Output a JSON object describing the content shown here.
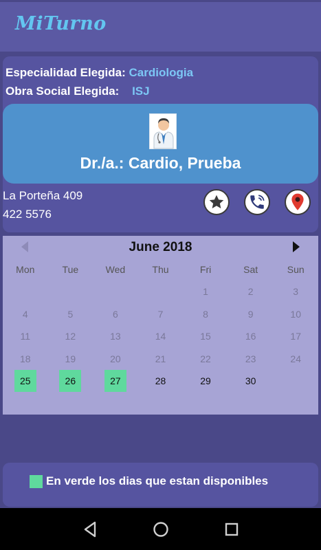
{
  "app": {
    "title": "MiTurno"
  },
  "info": {
    "specialty_label": "Especialidad Elegida:",
    "specialty_value": "Cardiologia",
    "insurance_label": "Obra Social Elegida:",
    "insurance_value": "ISJ"
  },
  "doctor": {
    "name": "Dr./a.: Cardio, Prueba",
    "address": "La Porteña 409",
    "phone": "422 5576"
  },
  "actions": {
    "favorite_icon": "star-icon",
    "call_icon": "phone-icon",
    "map_icon": "map-pin-icon"
  },
  "calendar": {
    "month_label": "June 2018",
    "weekdays": [
      "Mon",
      "Tue",
      "Wed",
      "Thu",
      "Fri",
      "Sat",
      "Sun"
    ],
    "days": [
      {
        "n": "1",
        "state": "past"
      },
      {
        "n": "2",
        "state": "past"
      },
      {
        "n": "3",
        "state": "past"
      },
      {
        "n": "4",
        "state": "past"
      },
      {
        "n": "5",
        "state": "past"
      },
      {
        "n": "6",
        "state": "past"
      },
      {
        "n": "7",
        "state": "past"
      },
      {
        "n": "8",
        "state": "past"
      },
      {
        "n": "9",
        "state": "past"
      },
      {
        "n": "10",
        "state": "past"
      },
      {
        "n": "11",
        "state": "past"
      },
      {
        "n": "12",
        "state": "past"
      },
      {
        "n": "13",
        "state": "past"
      },
      {
        "n": "14",
        "state": "past"
      },
      {
        "n": "15",
        "state": "past"
      },
      {
        "n": "16",
        "state": "past"
      },
      {
        "n": "17",
        "state": "past"
      },
      {
        "n": "18",
        "state": "past"
      },
      {
        "n": "19",
        "state": "past"
      },
      {
        "n": "20",
        "state": "past"
      },
      {
        "n": "21",
        "state": "past"
      },
      {
        "n": "22",
        "state": "past"
      },
      {
        "n": "23",
        "state": "past"
      },
      {
        "n": "24",
        "state": "past"
      },
      {
        "n": "25",
        "state": "available"
      },
      {
        "n": "26",
        "state": "available"
      },
      {
        "n": "27",
        "state": "available"
      },
      {
        "n": "28",
        "state": "future"
      },
      {
        "n": "29",
        "state": "future"
      },
      {
        "n": "30",
        "state": "future"
      }
    ],
    "first_weekday_index": 4
  },
  "legend": {
    "text": "En verde los dias que estan disponibles",
    "color": "#5fd99d"
  },
  "colors": {
    "background": "#4a4888",
    "panel": "#5654a0",
    "doctor_card": "#4f92cd",
    "accent_text": "#7cc7f5",
    "available": "#5fd99d"
  }
}
